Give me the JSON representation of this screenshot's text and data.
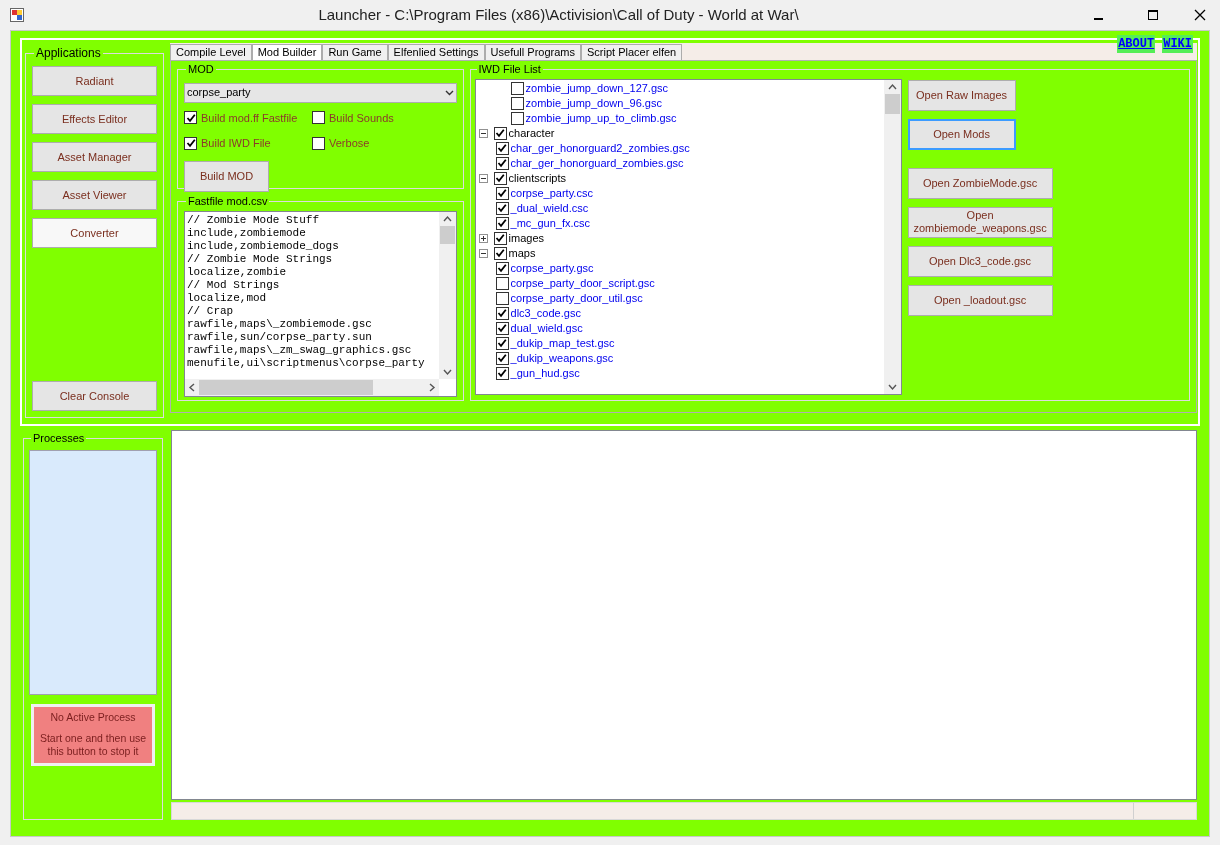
{
  "window": {
    "title": "Launcher - C:\\Program Files (x86)\\Activision\\Call of Duty - World at War\\"
  },
  "links": [
    "ABOUT",
    "WIKI"
  ],
  "applications": {
    "title": "Applications",
    "buttons": [
      {
        "label": "Radiant",
        "highlighted": false
      },
      {
        "label": "Effects Editor",
        "highlighted": false
      },
      {
        "label": "Asset Manager",
        "highlighted": false
      },
      {
        "label": "Asset Viewer",
        "highlighted": false
      },
      {
        "label": "Converter",
        "highlighted": true
      }
    ],
    "clear_button": "Clear Console"
  },
  "tabs": [
    {
      "label": "Compile Level",
      "selected": false
    },
    {
      "label": "Mod Builder",
      "selected": true
    },
    {
      "label": "Run Game",
      "selected": false
    },
    {
      "label": "Elfenlied Settings",
      "selected": false
    },
    {
      "label": "Usefull Programs",
      "selected": false
    },
    {
      "label": "Script Placer elfen",
      "selected": false
    }
  ],
  "mod": {
    "title": "MOD",
    "dropdown": "corpse_party",
    "options": [
      {
        "label": "Build mod.ff Fastfile",
        "checked": true
      },
      {
        "label": "Build Sounds",
        "checked": false
      },
      {
        "label": "Build IWD File",
        "checked": true
      },
      {
        "label": "Verbose",
        "checked": false
      }
    ],
    "build_button": "Build MOD"
  },
  "fastfile": {
    "title": "Fastfile mod.csv",
    "lines": [
      "// Zombie Mode Stuff",
      "include,zombiemode",
      "include,zombiemode_dogs",
      "// Zombie Mode Strings",
      "localize,zombie",
      "// Mod Strings",
      "localize,mod",
      "// Crap",
      "rawfile,maps\\_zombiemode.gsc",
      "rawfile,sun/corpse_party.sun",
      "rawfile,maps\\_zm_swag_graphics.gsc",
      "menufile,ui\\scriptmenus\\corpse_party"
    ]
  },
  "iwd": {
    "title": "IWD File List",
    "tree": [
      {
        "children": [
          {
            "children": [
              {
                "label": "zombie_jump_down_127.gsc",
                "kind": "file",
                "checked": false
              },
              {
                "label": "zombie_jump_down_96.gsc",
                "kind": "file",
                "checked": false
              },
              {
                "label": "zombie_jump_up_to_climb.gsc",
                "kind": "file",
                "checked": false
              }
            ]
          }
        ]
      },
      {
        "label": "character",
        "kind": "folder",
        "checked": true,
        "expanded": true,
        "children": [
          {
            "label": "char_ger_honorguard2_zombies.gsc",
            "kind": "file",
            "checked": true
          },
          {
            "label": "char_ger_honorguard_zombies.gsc",
            "kind": "file",
            "checked": true
          }
        ]
      },
      {
        "label": "clientscripts",
        "kind": "folder",
        "checked": true,
        "expanded": true,
        "children": [
          {
            "label": "corpse_party.csc",
            "kind": "file",
            "checked": true
          },
          {
            "label": "_dual_wield.csc",
            "kind": "file",
            "checked": true
          },
          {
            "label": "_mc_gun_fx.csc",
            "kind": "file",
            "checked": true
          }
        ]
      },
      {
        "label": "images",
        "kind": "folder",
        "checked": true,
        "expanded": false
      },
      {
        "label": "maps",
        "kind": "folder",
        "checked": true,
        "expanded": true,
        "children": [
          {
            "label": "corpse_party.gsc",
            "kind": "file",
            "checked": true
          },
          {
            "label": "corpse_party_door_script.gsc",
            "kind": "file",
            "checked": false
          },
          {
            "label": "corpse_party_door_util.gsc",
            "kind": "file",
            "checked": false
          },
          {
            "label": "dlc3_code.gsc",
            "kind": "file",
            "checked": true
          },
          {
            "label": "dual_wield.gsc",
            "kind": "file",
            "checked": true
          },
          {
            "label": "_dukip_map_test.gsc",
            "kind": "file",
            "checked": true
          },
          {
            "label": "_dukip_weapons.gsc",
            "kind": "file",
            "checked": true
          },
          {
            "label": "_gun_hud.gsc",
            "kind": "file",
            "checked": true
          }
        ]
      }
    ],
    "buttons": [
      {
        "label": "Open Raw Images",
        "focused": false
      },
      {
        "label": "Open Mods",
        "focused": true
      },
      {
        "label": "Open ZombieMode.gsc",
        "focused": false
      },
      {
        "label": "Open zombiemode_weapons.gsc",
        "focused": false
      },
      {
        "label": "Open Dlc3_code.gsc",
        "focused": false
      },
      {
        "label": "Open _loadout.gsc",
        "focused": false
      }
    ]
  },
  "processes": {
    "title": "Processes",
    "stop_button": [
      "No Active Process",
      "Start one and then use this button to stop it"
    ]
  }
}
